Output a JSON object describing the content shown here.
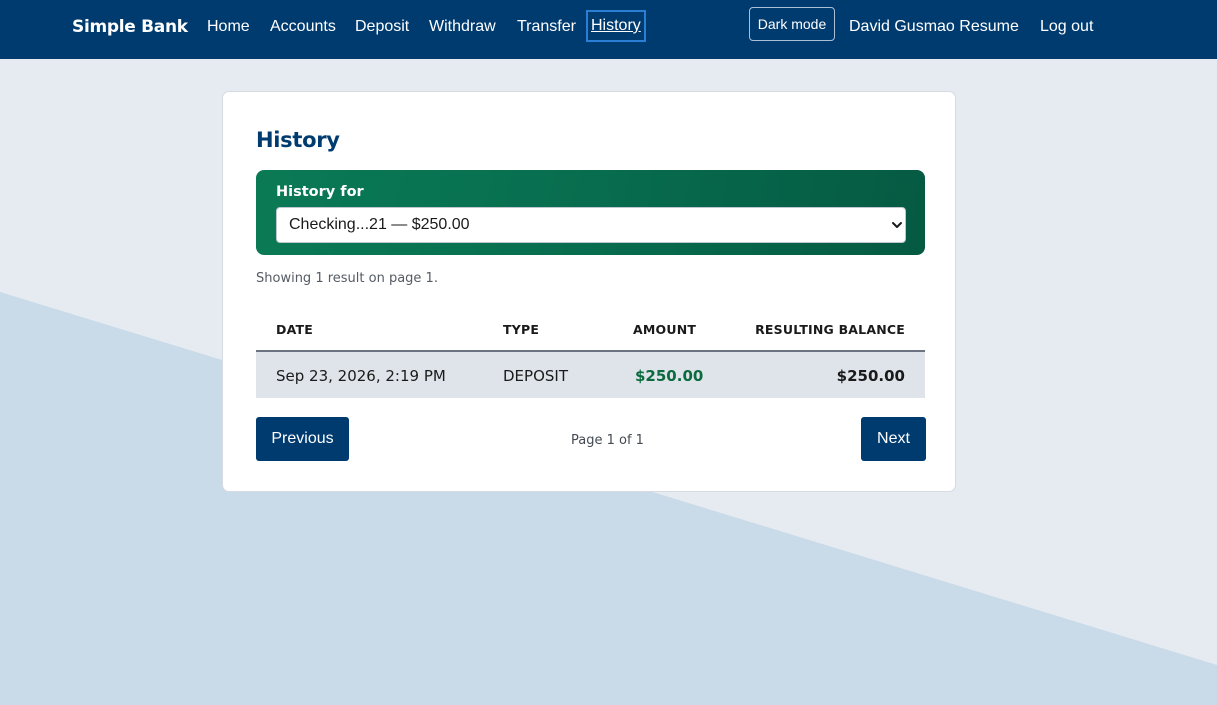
{
  "colors": {
    "navbar": "#003b70",
    "accent_green": "#0b6b3e",
    "history_panel": "#087050",
    "page_background": "#e6eaf1",
    "background_diagonal": "#c9dae8"
  },
  "nav": {
    "brand": "Simple Bank",
    "links": [
      "Home",
      "Accounts",
      "Deposit",
      "Withdraw",
      "Transfer",
      "History"
    ],
    "active": "History",
    "dark_mode_label": "Dark mode",
    "resume_label": "David Gusmao Resume",
    "logout_label": "Log out"
  },
  "main": {
    "title": "History",
    "history_for_label": "History for",
    "selected_account": "Checking...21 — $250.00",
    "summary": "Showing 1 result on page 1.",
    "table": {
      "headers": [
        "DATE",
        "TYPE",
        "AMOUNT",
        "RESULTING BALANCE"
      ],
      "rows": [
        {
          "date": "Sep 23, 2026, 2:19 PM",
          "type": "DEPOSIT",
          "amount": "$250.00",
          "balance": "$250.00"
        }
      ]
    },
    "pagination": {
      "previous_label": "Previous",
      "page_indicator": "Page 1 of 1",
      "next_label": "Next"
    }
  }
}
